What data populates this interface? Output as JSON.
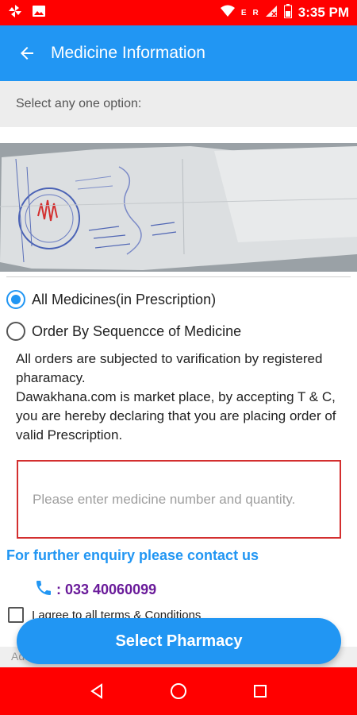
{
  "status_bar": {
    "left_icons": [
      "pinwheel-icon",
      "image-icon"
    ],
    "right_icons": [
      "wifi-icon",
      "signal-e-icon",
      "signal-r-icon",
      "battery-icon"
    ],
    "indicator_e": "E",
    "indicator_r": "R",
    "time": "3:35 PM"
  },
  "app_bar": {
    "title": "Medicine Information",
    "back_icon": "arrow-left-icon"
  },
  "hint": "Select any one option:",
  "options": [
    {
      "label": "All Medicines(in Prescription)",
      "selected": true
    },
    {
      "label": "Order By Sequencce of Medicine",
      "selected": false
    }
  ],
  "notice": {
    "line1": "All orders are subjected to varification by registered pharamacy.",
    "line2": "Dawakhana.com is market place, by accepting T & C, you are hereby declaring that you are placing order of valid Prescription."
  },
  "medicine_input": {
    "placeholder": "Please enter medicine number and quantity."
  },
  "enquiry": {
    "text": "For further enquiry please contact us",
    "phone": ": 033 40060099",
    "phone_icon": "phone-icon"
  },
  "terms": {
    "label": "I agree to all terms & Conditions"
  },
  "footer_partial": "Additional Note",
  "buttons": {
    "select_pharmacy": "Select Pharmacy"
  },
  "nav": [
    "back-triangle-icon",
    "home-circle-icon",
    "recents-square-icon"
  ],
  "colors": {
    "status": "#ff0000",
    "primary": "#2196f3",
    "phone": "#6a1b9a",
    "input_border": "#d32f2f"
  }
}
